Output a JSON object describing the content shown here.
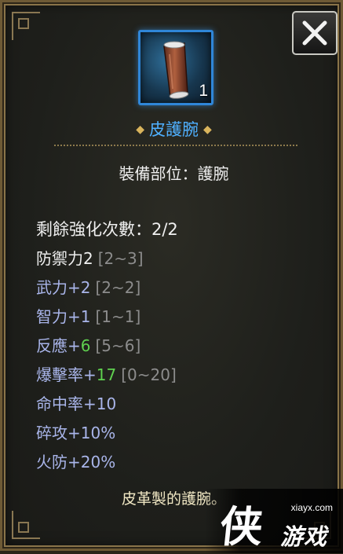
{
  "item": {
    "name": "皮護腕",
    "count": "1",
    "icon": "leather-bracer-icon",
    "slot_line": "裝備部位：護腕",
    "description": "皮革製的護腕。"
  },
  "stats": [
    {
      "label": "剩餘強化次數：2/2",
      "bonus": "",
      "range": ""
    },
    {
      "label": "防禦力2",
      "bonus": "",
      "range": "[2~3]"
    },
    {
      "label": "武力+2",
      "bonus": "",
      "range": "[2~2]"
    },
    {
      "label": "智力+1",
      "bonus": "",
      "range": "[1~1]"
    },
    {
      "label": "反應+",
      "bonus": "6",
      "range": "[5~6]"
    },
    {
      "label": "爆擊率+",
      "bonus": "17",
      "range": "[0~20]"
    },
    {
      "label": "命中率+10",
      "bonus": "",
      "range": ""
    },
    {
      "label": "碎攻+10%",
      "bonus": "",
      "range": ""
    },
    {
      "label": "火防+20%",
      "bonus": "",
      "range": ""
    }
  ],
  "watermark": {
    "site": "xiayx.com",
    "mark": "侠",
    "text": "游戏"
  },
  "colors": {
    "item_name": "#4fb0ff",
    "blue_stat": "#a9b5ea",
    "green_bonus": "#5fd14f",
    "range": "#8c8c8c",
    "frame": "#8a7449"
  },
  "close_icon": "close-icon"
}
